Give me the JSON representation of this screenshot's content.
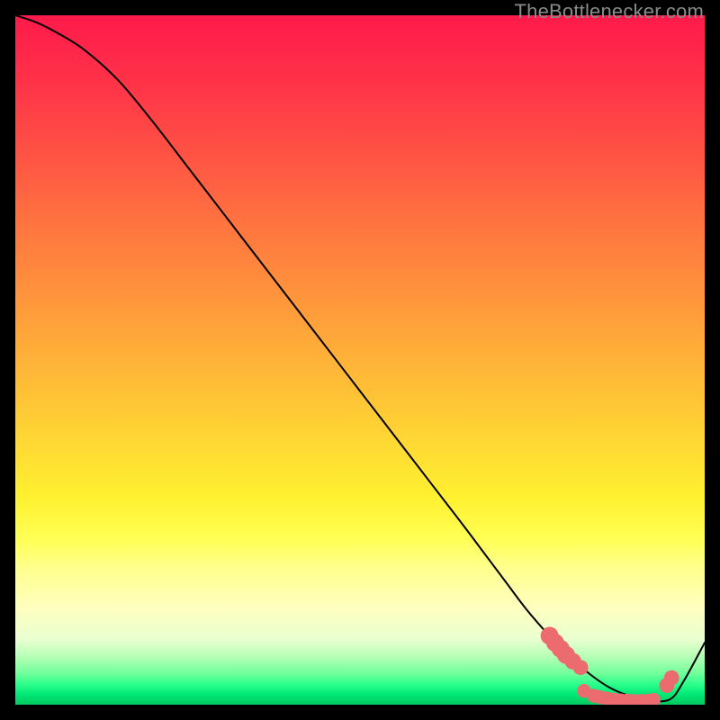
{
  "watermark": "TheBottlenecker.com",
  "colors": {
    "curve": "#000000",
    "marker_fill": "#ec6b6f",
    "marker_stroke": "#ec6b6f"
  },
  "gradient_stops": [
    {
      "offset": 0.0,
      "color": "#ff1a4b"
    },
    {
      "offset": 0.1,
      "color": "#ff3348"
    },
    {
      "offset": 0.2,
      "color": "#ff5244"
    },
    {
      "offset": 0.3,
      "color": "#ff7340"
    },
    {
      "offset": 0.4,
      "color": "#ff923c"
    },
    {
      "offset": 0.5,
      "color": "#ffb238"
    },
    {
      "offset": 0.6,
      "color": "#ffd234"
    },
    {
      "offset": 0.7,
      "color": "#fff130"
    },
    {
      "offset": 0.76,
      "color": "#ffff55"
    },
    {
      "offset": 0.8,
      "color": "#ffff8c"
    },
    {
      "offset": 0.86,
      "color": "#ffffc0"
    },
    {
      "offset": 0.905,
      "color": "#eaffd0"
    },
    {
      "offset": 0.93,
      "color": "#b6ffb6"
    },
    {
      "offset": 0.955,
      "color": "#70ff9a"
    },
    {
      "offset": 0.97,
      "color": "#2dff8c"
    },
    {
      "offset": 0.985,
      "color": "#00e876"
    },
    {
      "offset": 1.0,
      "color": "#00c95f"
    }
  ],
  "chart_data": {
    "type": "line",
    "title": "",
    "xlabel": "",
    "ylabel": "",
    "xlim": [
      0,
      100
    ],
    "ylim": [
      0,
      100
    ],
    "series": [
      {
        "name": "curve",
        "x": [
          0,
          3,
          6,
          10,
          15,
          20,
          25,
          30,
          35,
          40,
          45,
          50,
          55,
          60,
          65,
          68,
          71,
          74,
          77,
          80,
          83,
          86,
          89,
          92,
          95,
          97,
          100
        ],
        "y": [
          100,
          99,
          97.5,
          95,
          90.5,
          84.5,
          78,
          71.5,
          65,
          58.5,
          52,
          45.5,
          39,
          32.5,
          26,
          22,
          18,
          14,
          10.5,
          7.3,
          4.7,
          2.6,
          1.3,
          0.6,
          0.8,
          3.5,
          9
        ]
      }
    ],
    "markers": [
      {
        "x": 77.5,
        "y": 10.0,
        "r": 1.3
      },
      {
        "x": 78.3,
        "y": 9.0,
        "r": 1.3
      },
      {
        "x": 79.1,
        "y": 8.1,
        "r": 1.3
      },
      {
        "x": 79.9,
        "y": 7.2,
        "r": 1.3
      },
      {
        "x": 80.9,
        "y": 6.3,
        "r": 1.2
      },
      {
        "x": 82.0,
        "y": 5.4,
        "r": 1.1
      },
      {
        "x": 82.5,
        "y": 2.0,
        "r": 1.0
      },
      {
        "x": 83.9,
        "y": 1.3,
        "r": 1.0
      },
      {
        "x": 84.8,
        "y": 1.1,
        "r": 1.0
      },
      {
        "x": 85.8,
        "y": 0.9,
        "r": 1.0
      },
      {
        "x": 86.8,
        "y": 0.75,
        "r": 1.0
      },
      {
        "x": 87.8,
        "y": 0.65,
        "r": 1.0
      },
      {
        "x": 88.8,
        "y": 0.6,
        "r": 1.0
      },
      {
        "x": 89.8,
        "y": 0.55,
        "r": 1.0
      },
      {
        "x": 90.8,
        "y": 0.55,
        "r": 1.0
      },
      {
        "x": 91.8,
        "y": 0.6,
        "r": 1.0
      },
      {
        "x": 92.6,
        "y": 0.7,
        "r": 1.0
      },
      {
        "x": 94.5,
        "y": 2.8,
        "r": 1.1
      },
      {
        "x": 95.2,
        "y": 3.9,
        "r": 1.1
      }
    ]
  }
}
